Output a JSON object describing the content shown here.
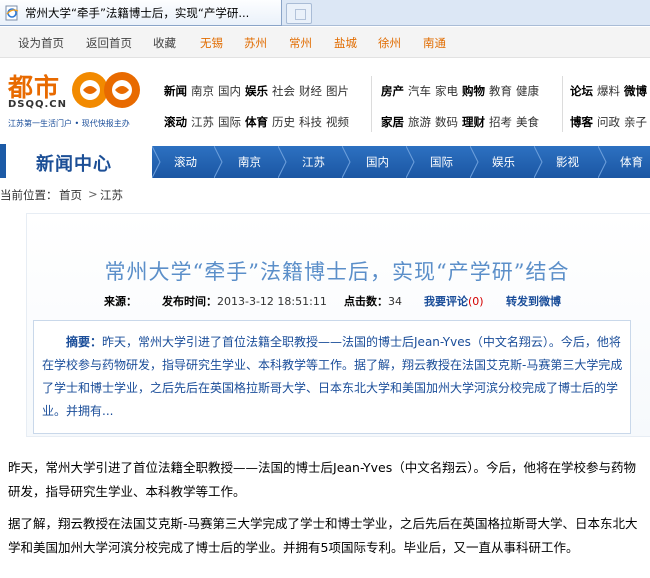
{
  "browser": {
    "tab_title": "常州大学“牵手”法籍博士后，实现“产学研..."
  },
  "toplinks": {
    "items": [
      {
        "label": "设为首页",
        "city": false
      },
      {
        "label": "返回首页",
        "city": false
      },
      {
        "label": "收藏",
        "city": false
      },
      {
        "label": "无锡",
        "city": true
      },
      {
        "label": "苏州",
        "city": true
      },
      {
        "label": "常州",
        "city": true
      },
      {
        "label": "盐城",
        "city": true
      },
      {
        "label": "徐州",
        "city": true
      },
      {
        "label": "南通",
        "city": true
      }
    ]
  },
  "logo": {
    "name": "都市",
    "url": "DSQQ.CN",
    "slogan": "江苏第一生活门户 • 现代快报主办"
  },
  "nav": {
    "group1": {
      "row1": [
        {
          "label": "新闻",
          "bold": true
        },
        {
          "label": "南京",
          "bold": false
        },
        {
          "label": "国内",
          "bold": false
        },
        {
          "label": "娱乐",
          "bold": true
        },
        {
          "label": "社会",
          "bold": false
        },
        {
          "label": "财经",
          "bold": false
        },
        {
          "label": "图片",
          "bold": false
        }
      ],
      "row2": [
        {
          "label": "滚动",
          "bold": true
        },
        {
          "label": "江苏",
          "bold": false
        },
        {
          "label": "国际",
          "bold": false
        },
        {
          "label": "体育",
          "bold": true
        },
        {
          "label": "历史",
          "bold": false
        },
        {
          "label": "科技",
          "bold": false
        },
        {
          "label": "视频",
          "bold": false
        }
      ]
    },
    "group2": {
      "row1": [
        {
          "label": "房产",
          "bold": true
        },
        {
          "label": "汽车",
          "bold": false
        },
        {
          "label": "家电",
          "bold": false
        },
        {
          "label": "购物",
          "bold": true
        },
        {
          "label": "教育",
          "bold": false
        },
        {
          "label": "健康",
          "bold": false
        }
      ],
      "row2": [
        {
          "label": "家居",
          "bold": true
        },
        {
          "label": "旅游",
          "bold": false
        },
        {
          "label": "数码",
          "bold": false
        },
        {
          "label": "理财",
          "bold": true
        },
        {
          "label": "招考",
          "bold": false
        },
        {
          "label": "美食",
          "bold": false
        }
      ]
    },
    "group3": {
      "row1": [
        {
          "label": "论坛",
          "bold": true
        },
        {
          "label": "爆料",
          "bold": false
        },
        {
          "label": "微博",
          "bold": true
        }
      ],
      "row2": [
        {
          "label": "博客",
          "bold": true
        },
        {
          "label": "问政",
          "bold": false
        },
        {
          "label": "亲子",
          "bold": false
        }
      ]
    }
  },
  "channel": {
    "title": "新闻中心",
    "items": [
      "滚动",
      "南京",
      "江苏",
      "国内",
      "国际",
      "娱乐",
      "影视",
      "体育"
    ]
  },
  "breadcrumb": {
    "prefix": "当前位置：",
    "home": "首页",
    "separator": ">",
    "current": "江苏"
  },
  "article": {
    "title": "常州大学“牵手”法籍博士后，实现“产学研”结合",
    "source_label": "来源：",
    "source_value": "",
    "time_label": "发布时间：",
    "time_value": "2013-3-12 18:51:11",
    "hits_label": "点击数：",
    "hits_value": "34",
    "comment_label": "我要评论",
    "comment_count": "(0)",
    "share_label": "转发到微博",
    "summary_label": "摘要：",
    "summary_text": "昨天，常州大学引进了首位法籍全职教授——法国的博士后Jean-Yves（中文名翔云）。今后，他将在学校参与药物研发，指导研究生学业、本科教学等工作。据了解，翔云教授在法国艾克斯-马赛第三大学完成了学士和博士学业，之后先后在英国格拉斯哥大学、日本东北大学和美国加州大学河滨分校完成了博士后的学业。并拥有...",
    "body": [
      "昨天，常州大学引进了首位法籍全职教授——法国的博士后Jean-Yves（中文名翔云）。今后，他将在学校参与药物研发，指导研究生学业、本科教学等工作。",
      "据了解，翔云教授在法国艾克斯-马赛第三大学完成了学士和博士学业，之后先后在英国格拉斯哥大学、日本东北大学和美国加州大学河滨分校完成了博士后的学业。并拥有5项国际专利。毕业后，又一直从事科研工作。"
    ]
  },
  "colors": {
    "accent_orange": "#e86a00",
    "nav_blue": "#1b56a3",
    "headline_blue": "#5b8fc9",
    "link_blue": "#1a4d99"
  },
  "icons": {
    "favicon": "ie-page-icon",
    "logo_badge": "mascot-logo"
  }
}
